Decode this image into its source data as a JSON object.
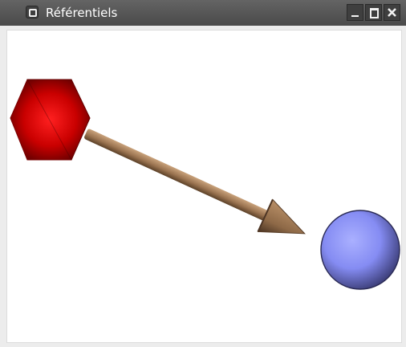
{
  "window": {
    "title": "Référentiels",
    "controls": {
      "minimize": "minimize",
      "maximize": "maximize",
      "close": "close"
    }
  },
  "scene": {
    "origin_shape": "hexagon",
    "target_shape": "sphere",
    "arrow": "vector-arrow",
    "colors": {
      "hexagon": "#d60000",
      "sphere": "#8f95ff",
      "arrow": "#9b7656"
    }
  }
}
